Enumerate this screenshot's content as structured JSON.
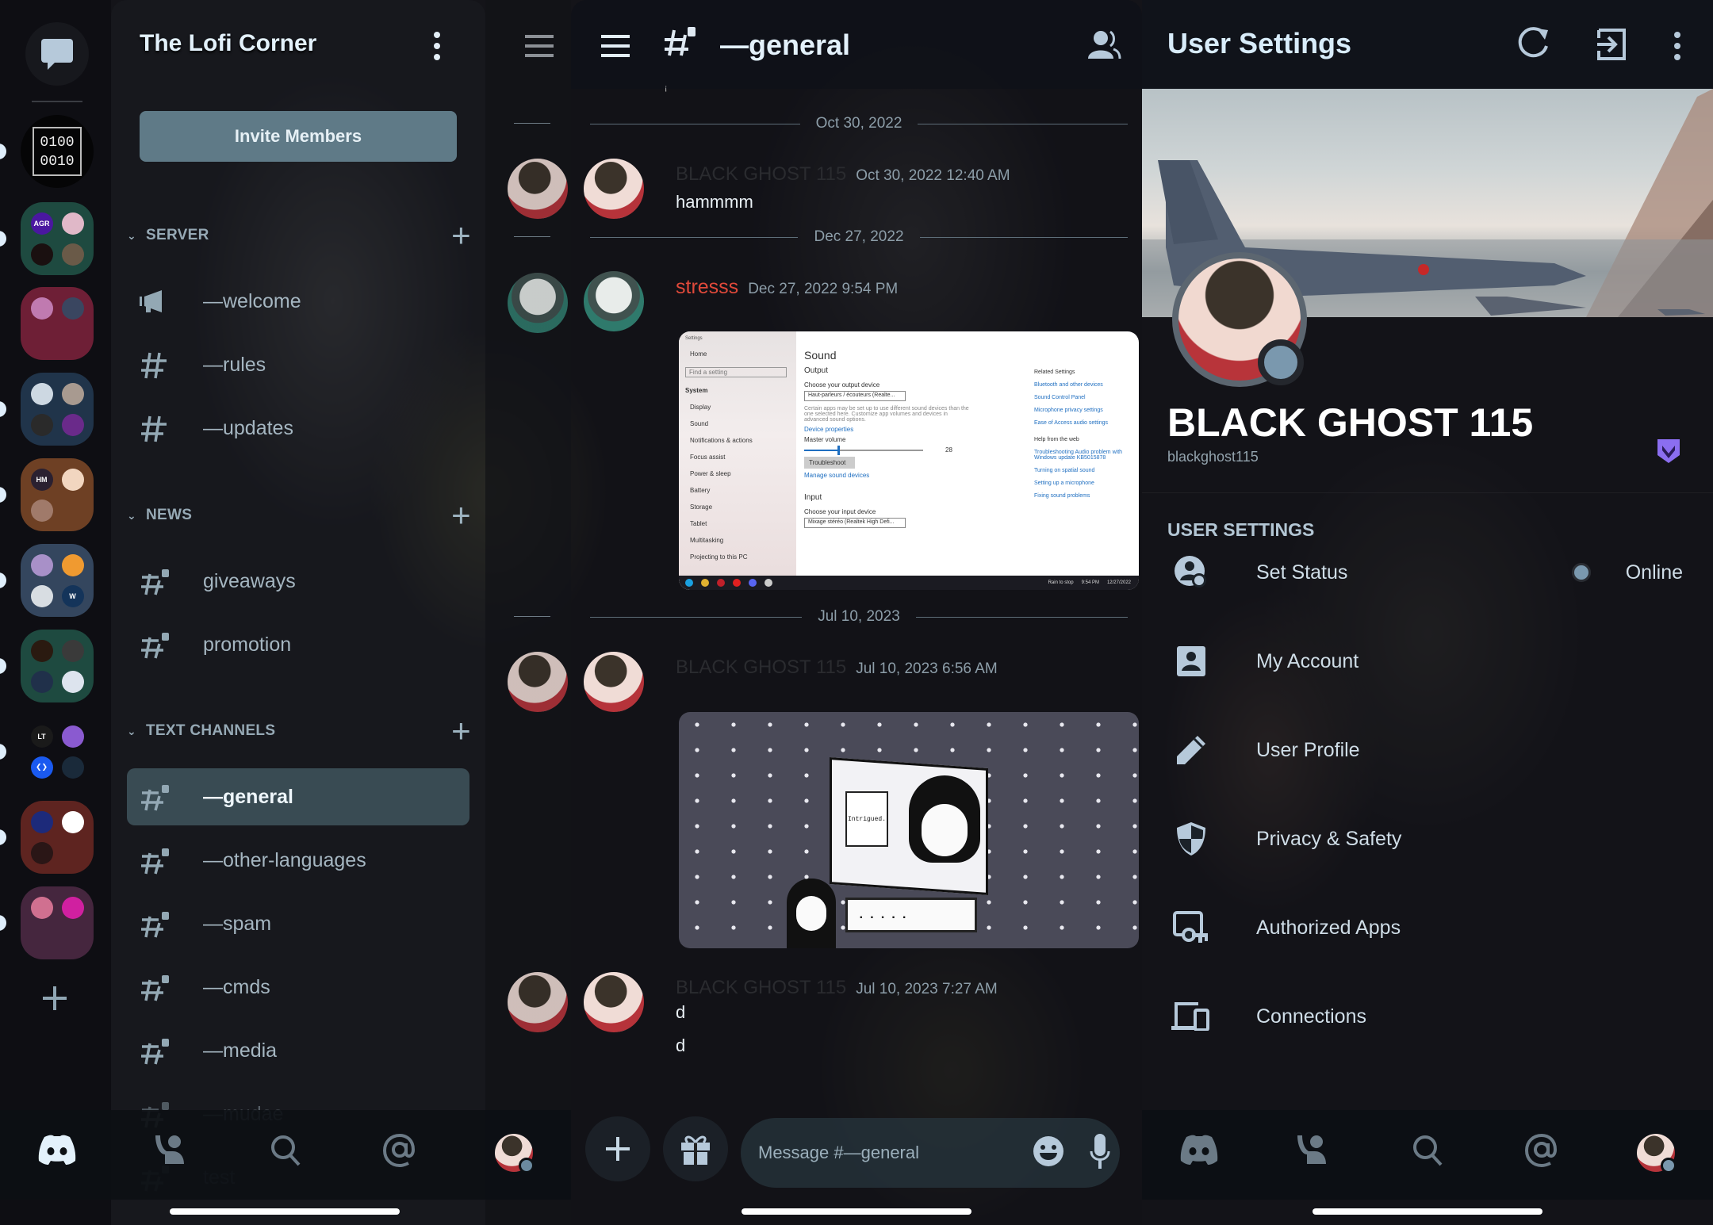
{
  "server_rail": {
    "dm_icon": "chat-bubble-icon",
    "binary_server_text": [
      "0100",
      "0010"
    ],
    "folders": [
      {
        "color": "#1e4a40",
        "avatars": [
          {
            "label": "AGR",
            "color": "#4a17a0"
          },
          {
            "label": "",
            "color": "#e0b8c8"
          },
          {
            "label": "",
            "color": "#1a1010"
          },
          {
            "label": "",
            "color": "#6a5a48"
          }
        ],
        "unread": true
      },
      {
        "color": "#6e1f36",
        "avatars": [
          {
            "label": "",
            "color": "#c07ab0"
          },
          {
            "label": "",
            "color": "#3a4660"
          }
        ],
        "unread": false
      },
      {
        "color": "#20344a",
        "avatars": [
          {
            "label": "",
            "color": "#cdd8e2"
          },
          {
            "label": "",
            "color": "#a89a90"
          },
          {
            "label": "",
            "color": "#2a2a2a"
          },
          {
            "label": "",
            "color": "#6a2a8a"
          }
        ],
        "unread": true
      },
      {
        "color": "#6e4024",
        "avatars": [
          {
            "label": "HM",
            "color": "#2a2030"
          },
          {
            "label": "",
            "color": "#f2d6c0"
          },
          {
            "label": "",
            "color": "#a07a6a"
          }
        ],
        "unread": true
      },
      {
        "color": "#34465e",
        "avatars": [
          {
            "label": "",
            "color": "#a890c8"
          },
          {
            "label": "",
            "color": "#f09a30"
          },
          {
            "label": "",
            "color": "#d8dde2"
          },
          {
            "label": "W",
            "color": "#14345a"
          }
        ],
        "unread": true
      },
      {
        "color": "#1e4a40",
        "avatars": [
          {
            "label": "",
            "color": "#2a1a10"
          },
          {
            "label": "",
            "color": "#3a3a3a"
          },
          {
            "label": "",
            "color": "#20304a"
          },
          {
            "label": "",
            "color": "#dde4ee"
          }
        ],
        "unread": true
      },
      {
        "color": "transparent",
        "avatars": [
          {
            "label": "LT",
            "color": "#1a1a1a"
          },
          {
            "label": "",
            "color": "#8a5ad0"
          },
          {
            "label": "❮❯",
            "color": "#1a5af0"
          },
          {
            "label": "",
            "color": "#1a2a3a"
          }
        ],
        "unread": true
      },
      {
        "color": "#5e2420",
        "avatars": [
          {
            "label": "",
            "color": "#1d2a7a"
          },
          {
            "label": "",
            "color": "#ffffff"
          },
          {
            "label": "",
            "color": "#2a1616"
          }
        ],
        "unread": true
      },
      {
        "color": "#45263e",
        "avatars": [
          {
            "label": "",
            "color": "#d07090"
          },
          {
            "label": "",
            "color": "#d020a0"
          }
        ],
        "unread": true
      }
    ],
    "add_server_icon": "plus-icon"
  },
  "channel_list": {
    "server_name": "The Lofi Corner",
    "invite_label": "Invite Members",
    "categories": [
      {
        "name": "SERVER",
        "channels": [
          {
            "name": "—welcome",
            "icon": "announcement",
            "locked": false
          },
          {
            "name": "—rules",
            "icon": "hash",
            "locked": false
          },
          {
            "name": "—updates",
            "icon": "hash",
            "locked": false
          }
        ]
      },
      {
        "name": "NEWS",
        "channels": [
          {
            "name": "giveaways",
            "icon": "hash",
            "locked": true
          },
          {
            "name": "promotion",
            "icon": "hash",
            "locked": true
          }
        ]
      },
      {
        "name": "TEXT CHANNELS",
        "channels": [
          {
            "name": "—general",
            "icon": "hash",
            "locked": true,
            "active": true
          },
          {
            "name": "—other-languages",
            "icon": "hash",
            "locked": true
          },
          {
            "name": "—spam",
            "icon": "hash",
            "locked": true
          },
          {
            "name": "—cmds",
            "icon": "hash",
            "locked": true
          },
          {
            "name": "—media",
            "icon": "hash",
            "locked": true
          },
          {
            "name": "—mudae",
            "icon": "hash",
            "locked": true
          },
          {
            "name": "test",
            "icon": "hash",
            "locked": true
          }
        ]
      }
    ]
  },
  "chat": {
    "channel_name": "—general",
    "dividers": [
      "Oct 30, 2022",
      "Dec 27, 2022",
      "Jul 10, 2023"
    ],
    "messages": [
      {
        "author": "BLACK GHOST 115",
        "timestamp": "Oct 30, 2022 12:40 AM",
        "lines": [
          "hammmm"
        ]
      },
      {
        "author": "stresss",
        "author_color": "#e0493a",
        "timestamp": "Dec 27, 2022 9:54 PM",
        "lines": [],
        "attachment": "windows-sound-settings-screenshot"
      },
      {
        "author": "BLACK GHOST 115",
        "timestamp": "Jul 10, 2023 6:56 AM",
        "lines": [],
        "attachment": "komi-intrigued-image"
      },
      {
        "author": "BLACK GHOST 115",
        "timestamp": "Jul 10, 2023 7:27 AM",
        "lines": [
          "d",
          "d"
        ]
      }
    ],
    "win_screenshot": {
      "title": "Settings",
      "home": "Home",
      "search": "Find a setting",
      "section": "System",
      "nav": [
        "Display",
        "Sound",
        "Notifications & actions",
        "Focus assist",
        "Power & sleep",
        "Battery",
        "Storage",
        "Tablet",
        "Multitasking",
        "Projecting to this PC"
      ],
      "heading": "Sound",
      "output": "Output",
      "output_label": "Choose your output device",
      "output_device": "Haut-parleurs / écouteurs (Realte...",
      "note": "Certain apps may be set up to use different sound devices than the one selected here. Customize app volumes and devices in advanced sound options.",
      "device_props": "Device properties",
      "master_volume": "Master volume",
      "volume_value": 28,
      "troubleshoot": "Troubleshoot",
      "manage": "Manage sound devices",
      "input": "Input",
      "input_label": "Choose your input device",
      "input_device": "Mixage stéréo (Realtek High Defi...",
      "related": "Related Settings",
      "related_links": [
        "Bluetooth and other devices",
        "Sound Control Panel",
        "Microphone privacy settings",
        "Ease of Access audio settings"
      ],
      "help": "Help from the web",
      "help_links": [
        "Troubleshooting Audio problem with Windows update KB5015878",
        "Turning on spatial sound",
        "Setting up a microphone",
        "Fixing sound problems"
      ],
      "tray_weather": "Rain to stop",
      "tray_time": "9:54 PM",
      "tray_date": "12/27/2022"
    },
    "komi_image": {
      "tag": "Intrigued.",
      "dialog": "....."
    },
    "composer_placeholder": "Message #—general"
  },
  "settings": {
    "title": "User Settings",
    "display_name": "BLACK GHOST 115",
    "username": "blackghost115",
    "status_color": "#7a98ae",
    "badge_color": "#8b6ef0",
    "section_label": "USER SETTINGS",
    "items": [
      {
        "label": "Set Status",
        "icon": "set-status-icon",
        "value": "Online"
      },
      {
        "label": "My Account",
        "icon": "account-icon"
      },
      {
        "label": "User Profile",
        "icon": "pencil-icon"
      },
      {
        "label": "Privacy & Safety",
        "icon": "shield-icon"
      },
      {
        "label": "Authorized Apps",
        "icon": "authorized-apps-icon"
      },
      {
        "label": "Connections",
        "icon": "devices-icon"
      }
    ]
  },
  "bottom_nav": [
    "discord-home",
    "friends",
    "search",
    "mentions",
    "profile"
  ]
}
